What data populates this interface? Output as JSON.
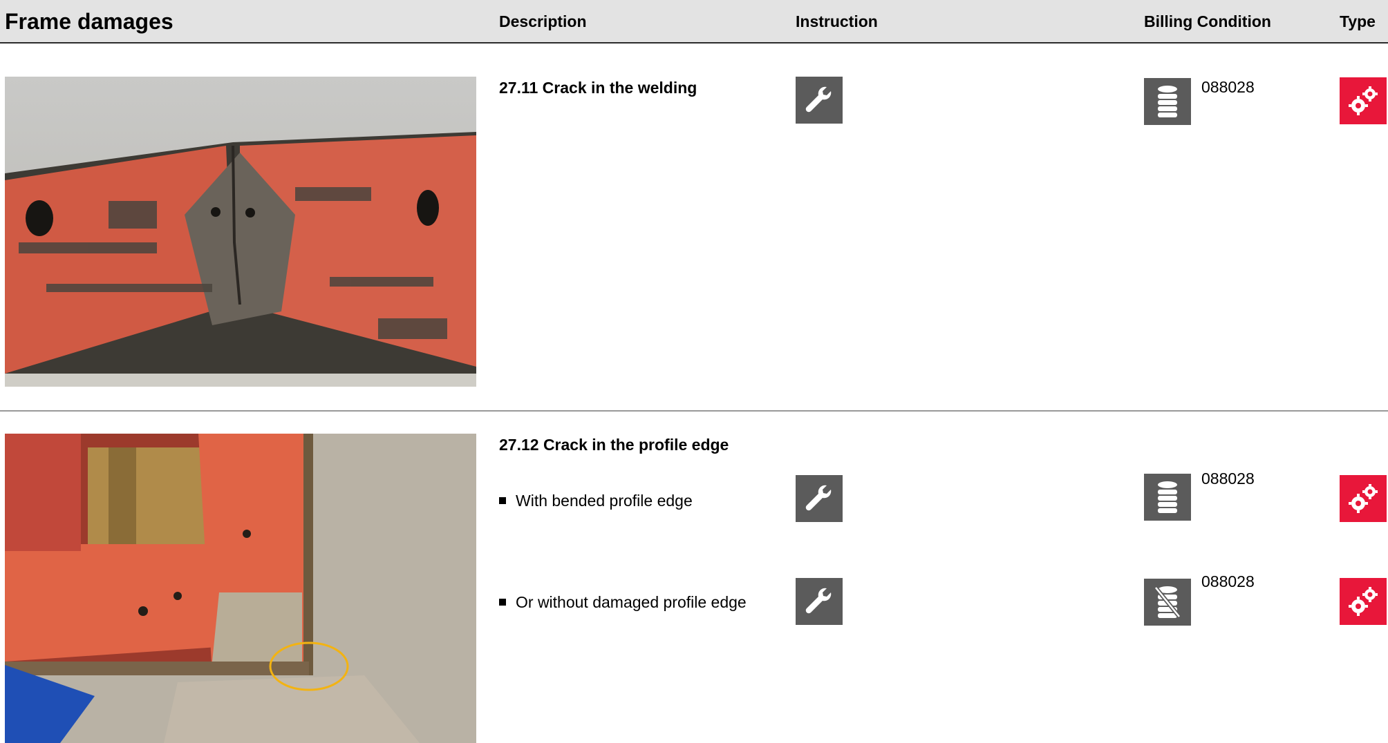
{
  "header": {
    "title": "Frame damages",
    "description": "Description",
    "instruction": "Instruction",
    "billing_condition": "Billing Condition",
    "type": "Type"
  },
  "items": [
    {
      "title": "27.11 Crack in the welding",
      "rows": [
        {
          "label": "",
          "instruction_icon": "wrench-icon",
          "billing_icon": "coin-stack-icon",
          "billing_code": "088028",
          "type_icon": "gears-icon"
        }
      ]
    },
    {
      "title": "27.12 Crack in the profile edge",
      "rows": [
        {
          "label": "With bended profile edge",
          "instruction_icon": "wrench-icon",
          "billing_icon": "coin-stack-icon",
          "billing_code": "088028",
          "type_icon": "gears-icon"
        },
        {
          "label": "Or without damaged profile edge",
          "instruction_icon": "wrench-icon",
          "billing_icon": "coin-stack-crossed-icon",
          "billing_code": "088028",
          "type_icon": "gears-icon"
        }
      ]
    }
  ],
  "colors": {
    "header_bg": "#e3e3e3",
    "icon_grey": "#5b5b5b",
    "type_red": "#e8173a",
    "marker": "#f3b312"
  }
}
